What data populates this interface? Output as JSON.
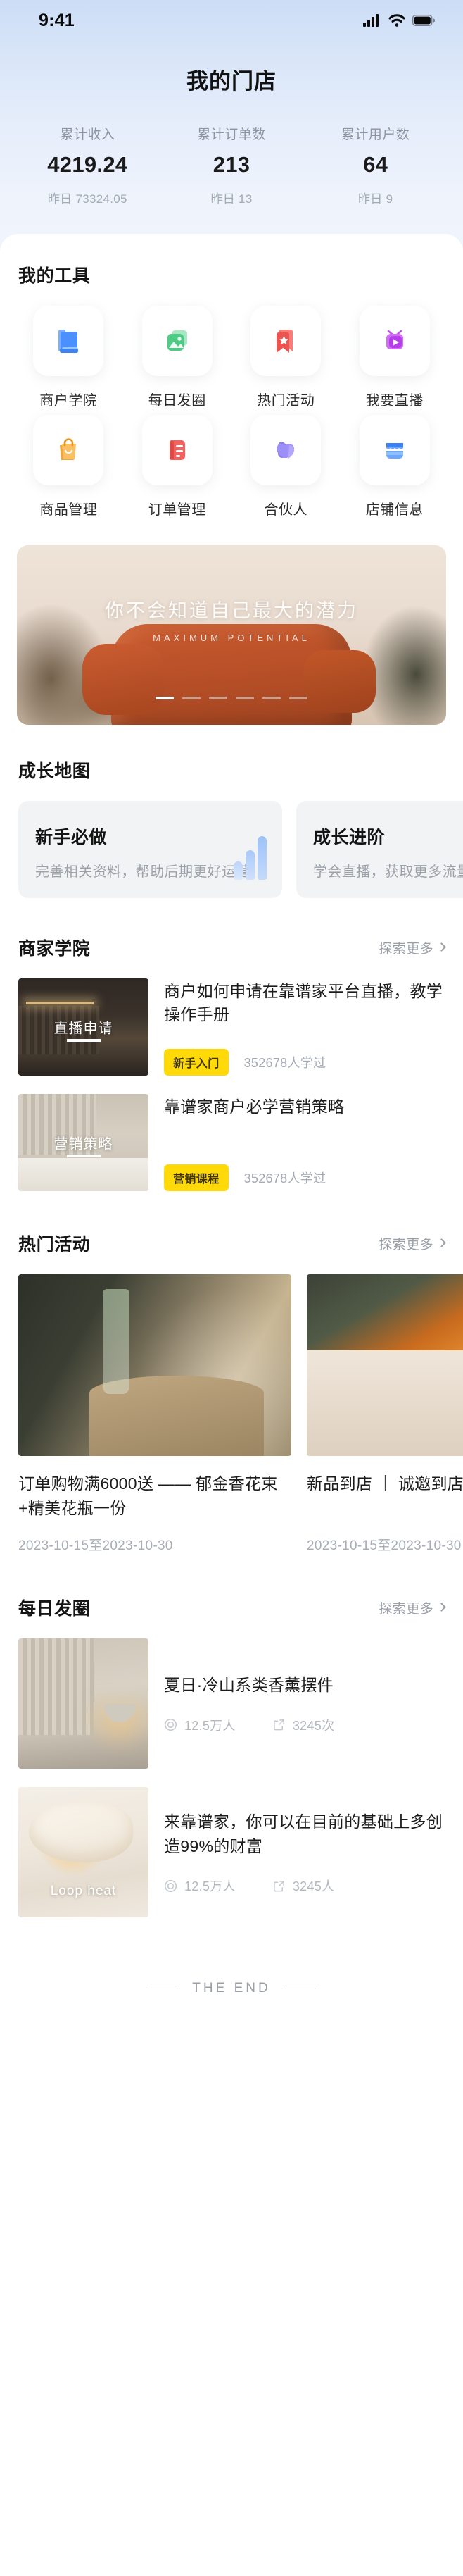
{
  "status_bar": {
    "time": "9:41",
    "icons": [
      "cellular-signal-icon",
      "wifi-icon",
      "battery-icon"
    ]
  },
  "nav": {
    "title": "我的门店"
  },
  "stats": [
    {
      "label": "累计收入",
      "value": "4219.24",
      "sub": "昨日 73324.05"
    },
    {
      "label": "累计订单数",
      "value": "213",
      "sub": "昨日 13"
    },
    {
      "label": "累计用户数",
      "value": "64",
      "sub": "昨日 9"
    }
  ],
  "tools": {
    "title": "我的工具",
    "items": [
      {
        "label": "商户学院",
        "icon": "books-icon",
        "color": "#4a90ff"
      },
      {
        "label": "每日发圈",
        "icon": "photos-icon",
        "color": "#54d08a"
      },
      {
        "label": "热门活动",
        "icon": "bookmark-star-icon",
        "color": "#f5605e"
      },
      {
        "label": "我要直播",
        "icon": "tv-play-icon",
        "color": "#c353f0"
      },
      {
        "label": "商品管理",
        "icon": "shopping-bag-icon",
        "color": "#f5a623"
      },
      {
        "label": "订单管理",
        "icon": "order-doc-icon",
        "color": "#f4625f"
      },
      {
        "label": "合伙人",
        "icon": "partner-heart-icon",
        "color": "#8b7cf6"
      },
      {
        "label": "店铺信息",
        "icon": "storefront-icon",
        "color": "#4b9bff"
      }
    ]
  },
  "banner": {
    "title": "你不会知道自己最大的潜力",
    "subtitle": "MAXIMUM POTENTIAL",
    "dots_total": 6,
    "dots_active": 1
  },
  "growth": {
    "title": "成长地图",
    "cards": [
      {
        "title": "新手必做",
        "sub": "完善相关资料，帮助后期更好运营"
      },
      {
        "title": "成长进阶",
        "sub": "学会直播，获取更多流量"
      }
    ]
  },
  "academy": {
    "title": "商家学院",
    "more": "探索更多",
    "courses": [
      {
        "title": "商户如何申请在靠谱家平台直播，教学操作手册",
        "thumb_caption": "直播申请",
        "tag": "新手入门",
        "count": "352678人学过"
      },
      {
        "title": "靠谱家商户必学营销策略",
        "thumb_caption": "营销策略",
        "tag": "营销课程",
        "count": "352678人学过"
      }
    ]
  },
  "hot": {
    "title": "热门活动",
    "more": "探索更多",
    "cards": [
      {
        "text": "订单购物满6000送 —— 郁金香花束+精美花瓶一份",
        "date": "2023-10-15至2023-10-30"
      },
      {
        "text": "新品到店 ｜ 诚邀到店体验",
        "date": "2023-10-15至2023-10-30"
      }
    ]
  },
  "daily": {
    "title": "每日发圈",
    "more": "探索更多",
    "posts": [
      {
        "title": "夏日·冷山系类香薰摆件",
        "thumb_caption": "",
        "views": "12.5万人",
        "shares": "3245次"
      },
      {
        "title": "来靠谱家，你可以在目前的基础上多创造99%的财富",
        "thumb_caption": "Loop heat",
        "views": "12.5万人",
        "shares": "3245人"
      }
    ]
  },
  "footer": {
    "end_text": "THE END"
  },
  "colors": {
    "header_gradient_start": "#ccddf6",
    "header_gradient_end": "#f1f5fd",
    "tag_yellow": "#ffd908",
    "text_primary": "#1c1c1c",
    "text_muted": "#a4aab3"
  }
}
